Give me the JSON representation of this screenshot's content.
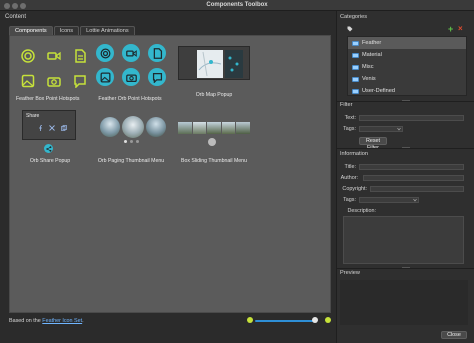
{
  "window": {
    "title": "Components Toolbox"
  },
  "content_label": "Content",
  "tabs": [
    {
      "label": "Components",
      "active": true
    },
    {
      "label": "Icons",
      "active": false
    },
    {
      "label": "Lottie Animations",
      "active": false
    }
  ],
  "components": [
    {
      "label": "Feather Box Point Hotspots"
    },
    {
      "label": "Feather Orb Point Hotspots"
    },
    {
      "label": "Orb Map Popup"
    },
    {
      "label": "Orb Share Popup",
      "share_title": "Share"
    },
    {
      "label": "Orb Paging Thumbnail Menu"
    },
    {
      "label": "Box Sliding Thumbnail Menu"
    }
  ],
  "footer": {
    "prefix": "Based on the ",
    "link": "Feather Icon Set",
    "suffix": "."
  },
  "right": {
    "categories_title": "Categories",
    "categories": [
      "Feather",
      "Material",
      "Misc",
      "Venis",
      "User-Defined"
    ],
    "selected_category": "Feather",
    "filter_title": "Filter",
    "filter_text_label": "Text:",
    "filter_tags_label": "Tags:",
    "reset_filter": "Reset Filter",
    "information_title": "Information",
    "info_title_label": "Title:",
    "info_author_label": "Author:",
    "info_copyright_label": "Copyright:",
    "info_tags_label": "Tags:",
    "info_description_label": "Description:",
    "preview_title": "Preview",
    "close_button": "Close"
  },
  "colors": {
    "feather_yellow": "#c6e23a",
    "orb_cyan": "#33b7cd",
    "accent_blue": "#2e8fd6",
    "add_green": "#5fc24a",
    "remove_red": "#e04a2e"
  }
}
